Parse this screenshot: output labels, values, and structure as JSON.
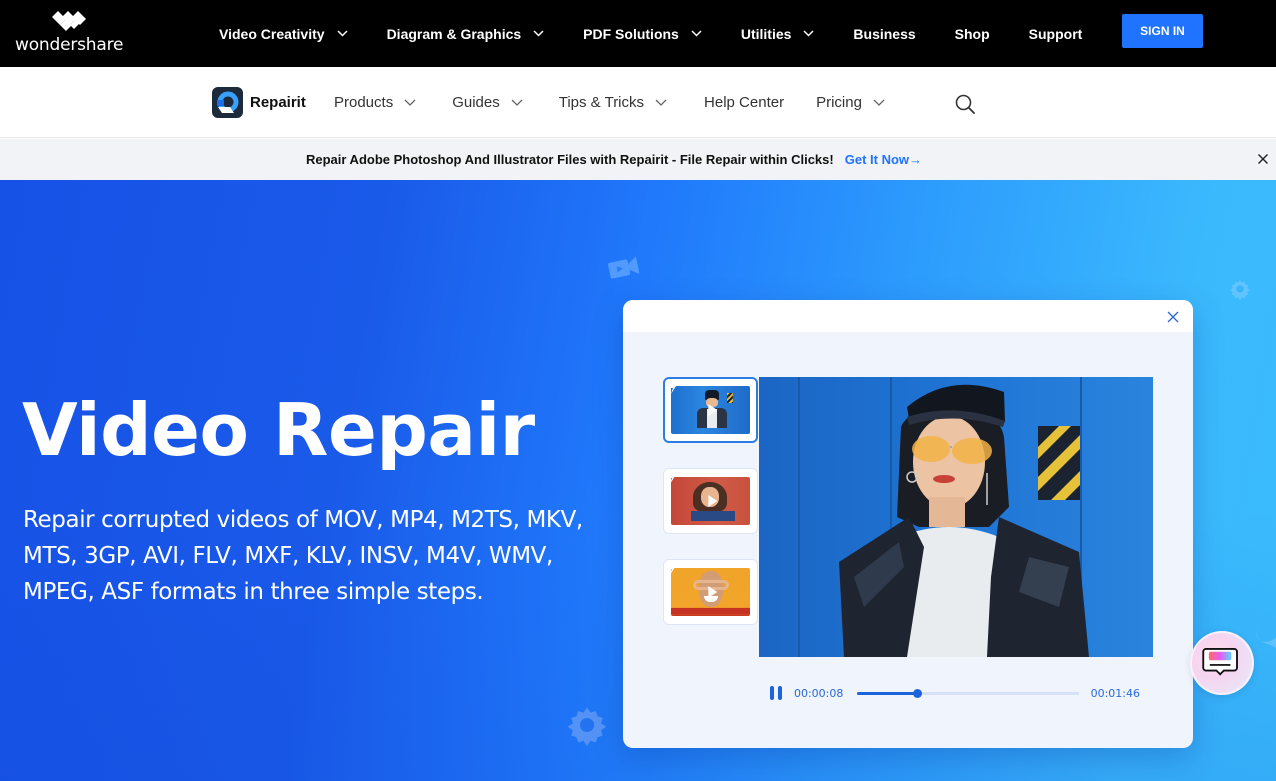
{
  "topbar": {
    "brand": "wondershare",
    "nav": [
      {
        "label": "Video Creativity",
        "has_dropdown": true
      },
      {
        "label": "Diagram & Graphics",
        "has_dropdown": true
      },
      {
        "label": "PDF Solutions",
        "has_dropdown": true
      },
      {
        "label": "Utilities",
        "has_dropdown": true
      },
      {
        "label": "Business",
        "has_dropdown": false
      },
      {
        "label": "Shop",
        "has_dropdown": false
      },
      {
        "label": "Support",
        "has_dropdown": false
      }
    ],
    "signin_label": "SIGN IN"
  },
  "subnav": {
    "product_name": "Repairit",
    "items": [
      {
        "label": "Products",
        "has_dropdown": true
      },
      {
        "label": "Guides",
        "has_dropdown": true
      },
      {
        "label": "Tips & Tricks",
        "has_dropdown": true
      },
      {
        "label": "Help Center",
        "has_dropdown": false
      },
      {
        "label": "Pricing",
        "has_dropdown": true
      }
    ],
    "search_icon": "search-icon"
  },
  "promo": {
    "message": "Repair Adobe Photoshop And Illustrator Files with Repairit - File Repair within Clicks!",
    "cta": "Get It Now→"
  },
  "hero": {
    "title": "Video Repair",
    "description": "Repair corrupted videos of MOV, MP4, M2TS, MKV, MTS, 3GP, AVI, FLV, MXF, KLV, INSV, M4V, WMV, MPEG, ASF formats in three simple steps."
  },
  "player": {
    "thumbnails": [
      {
        "subject": "woman in leather cap, blue wall",
        "active": true
      },
      {
        "subject": "smiling woman, red background",
        "active": false
      },
      {
        "subject": "woman with hand goggles, yellow background",
        "active": false
      }
    ],
    "current_time": "00:00:08",
    "total_time": "00:01:46",
    "progress_percent": 27
  },
  "colors": {
    "accent": "#1f73ff",
    "player_blue": "#1c63dc",
    "hero_start": "#1652e6",
    "hero_end": "#3abcfd"
  }
}
